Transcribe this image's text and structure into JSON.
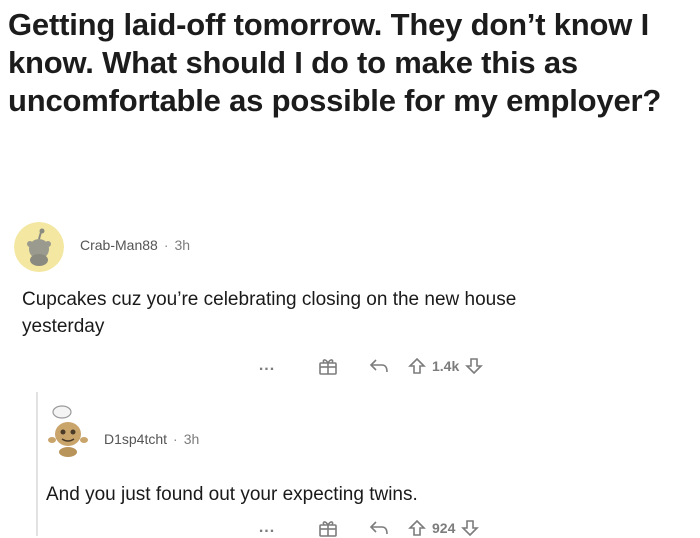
{
  "post": {
    "title": "Getting laid-off tomorrow. They don’t know I know. What should I do to make this as uncomfortable as possible for my employer?"
  },
  "comments": [
    {
      "username": "Crab-Man88",
      "separator": "·",
      "age": "3h",
      "avatar_icon": "snoo-avatar-yellow",
      "body": "Cupcakes cuz you’re celebrating closing on the new house yesterday",
      "more_label": "...",
      "score": "1.4k"
    },
    {
      "username": "D1sp4tcht",
      "separator": "·",
      "age": "3h",
      "avatar_icon": "snoo-avatar-chef",
      "body": "And you just found out your expecting twins.",
      "more_label": "...",
      "score": "924"
    }
  ],
  "colors": {
    "text": "#1a1a1b",
    "meta": "#7c7c7c",
    "avatar_yellow": "#f3e7a1"
  }
}
